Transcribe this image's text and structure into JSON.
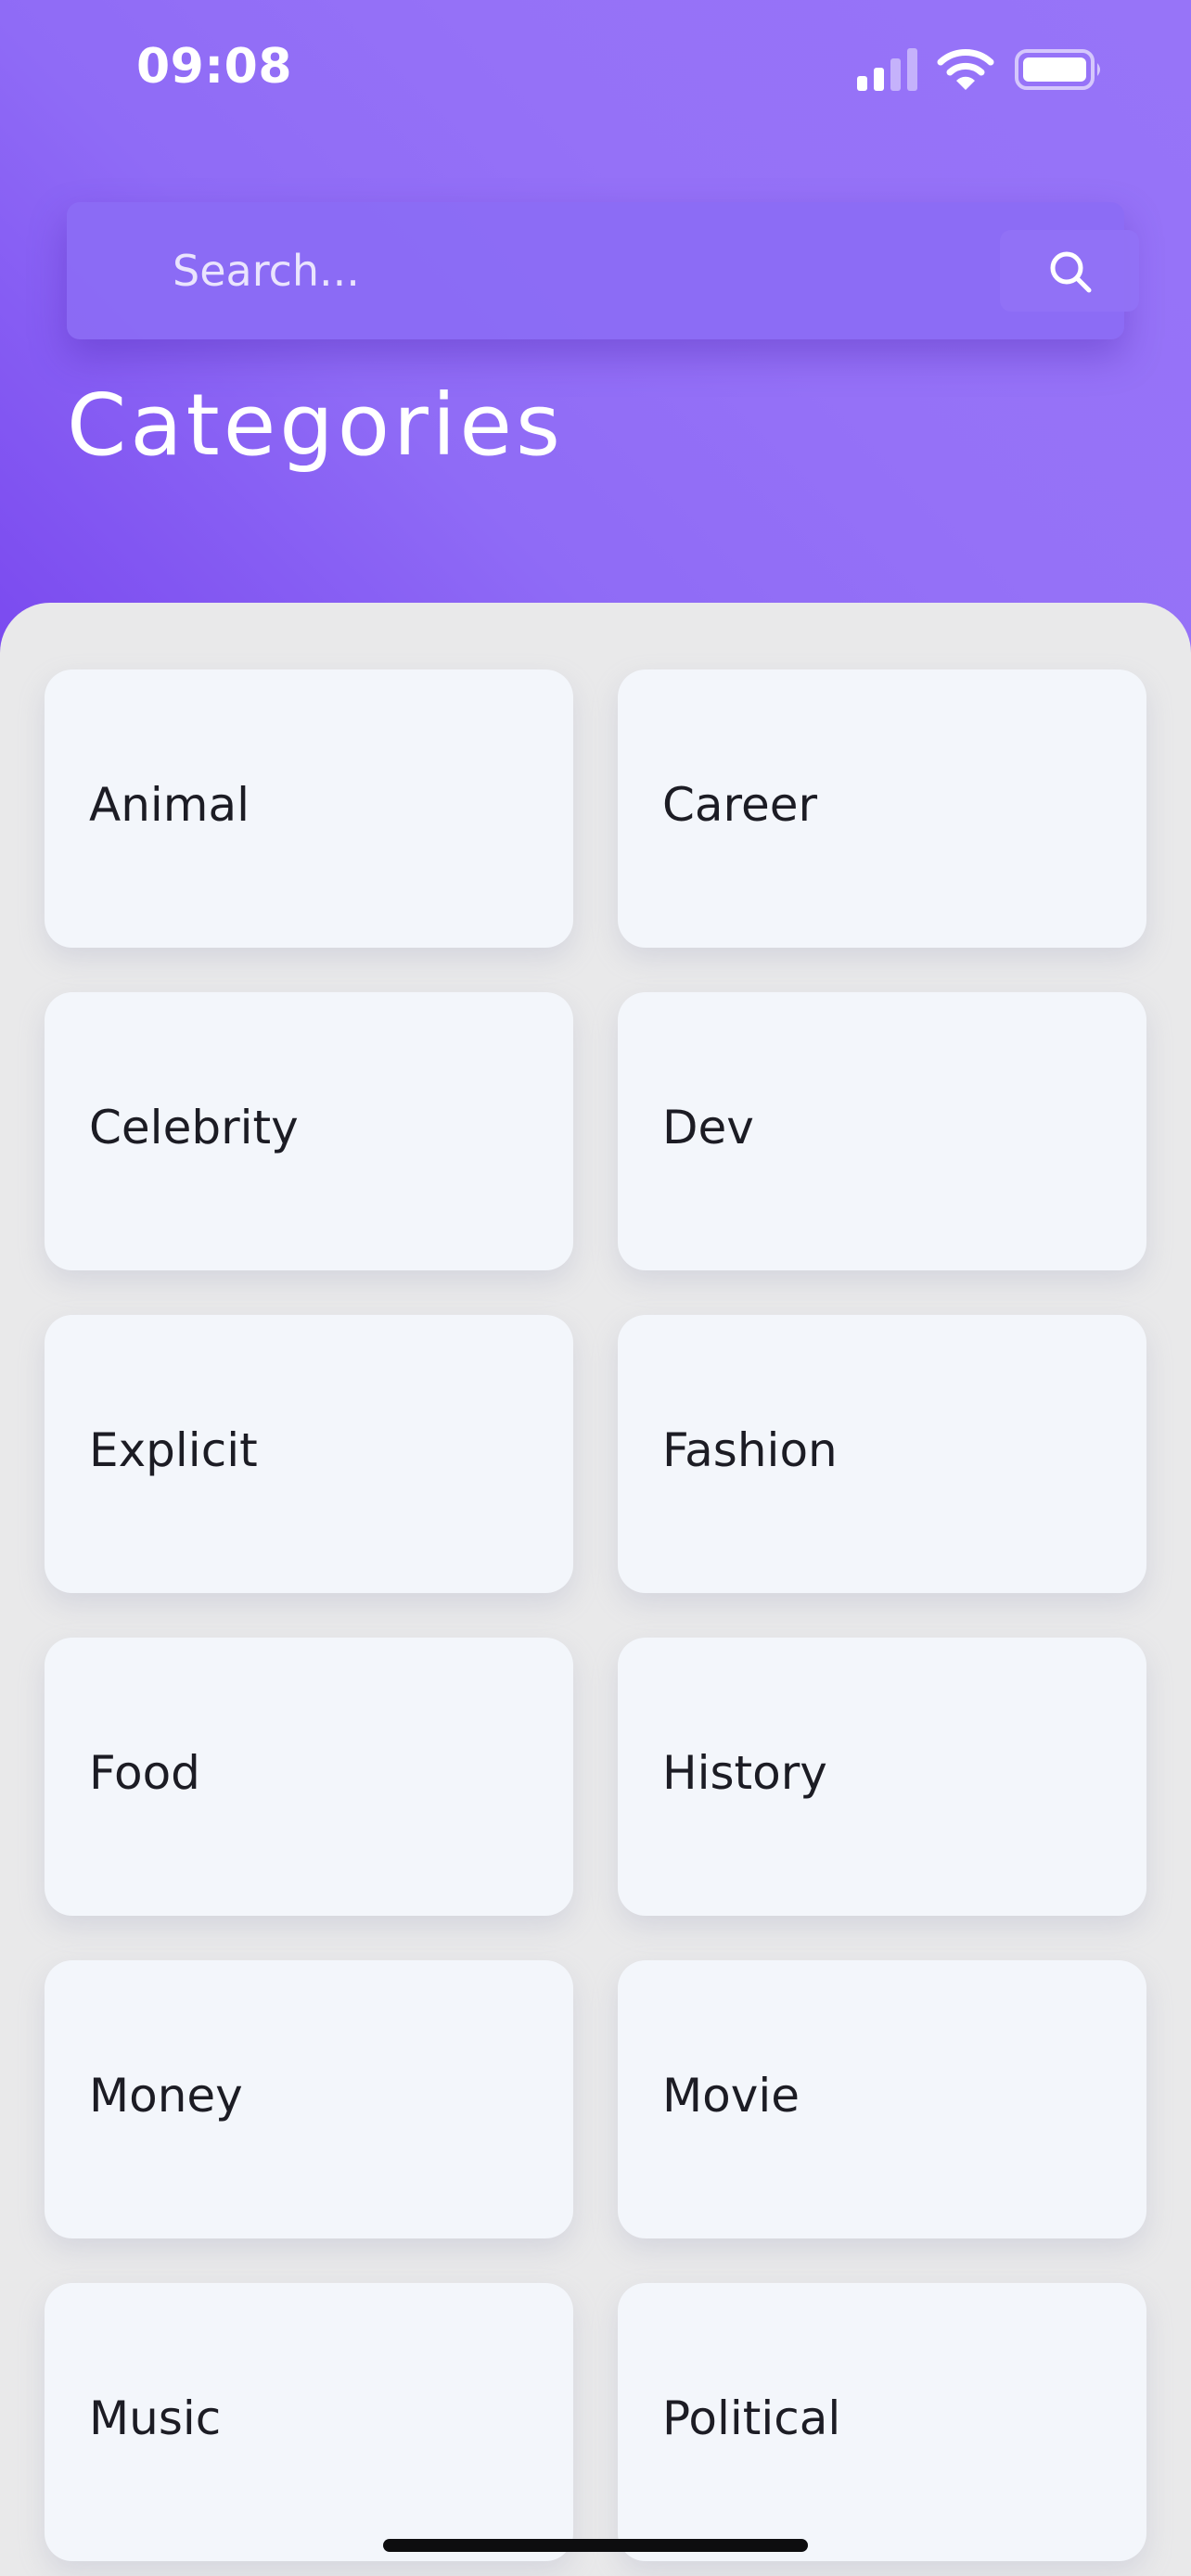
{
  "status_bar": {
    "time": "09:08"
  },
  "search": {
    "placeholder": "Search..."
  },
  "page": {
    "title": "Categories"
  },
  "categories": [
    {
      "label": "Animal"
    },
    {
      "label": "Career"
    },
    {
      "label": "Celebrity"
    },
    {
      "label": "Dev"
    },
    {
      "label": "Explicit"
    },
    {
      "label": "Fashion"
    },
    {
      "label": "Food"
    },
    {
      "label": "History"
    },
    {
      "label": "Money"
    },
    {
      "label": "Movie"
    },
    {
      "label": "Music"
    },
    {
      "label": "Political"
    }
  ],
  "icons": {
    "signal": "signal-icon",
    "wifi": "wifi-icon",
    "battery": "battery-icon",
    "search": "search-icon"
  },
  "colors": {
    "header_gradient_start": "#7a49ef",
    "header_gradient_end": "#9774f8",
    "background": "#e9e9ea",
    "card": "#f3f6fb",
    "card_text": "#1c1c24"
  }
}
